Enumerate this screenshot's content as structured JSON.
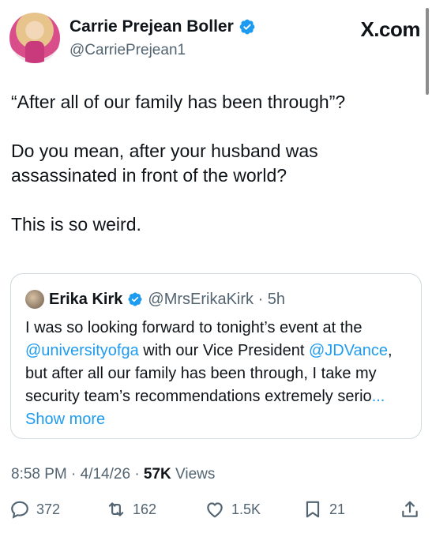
{
  "header": {
    "display_name": "Carrie Prejean Boller",
    "handle": "@CarriePrejean1",
    "site_label": "X.com"
  },
  "post": {
    "paragraphs": [
      "“After all of our family has been through”?",
      "Do you mean, after your husband was assassinated in front of the world?",
      "This is so weird."
    ]
  },
  "quoted": {
    "name": "Erika Kirk",
    "handle_time": "@MrsErikaKirk · 5h",
    "text_parts": {
      "p1": "I was so looking forward to tonight’s event at the ",
      "mention1": "@universityofga",
      "p2": " with our Vice President ",
      "mention2": "@JDVance",
      "p3": ", but after all our family has been through, I take my security team’s recommendations extremely serio",
      "show_more": "... Show more"
    }
  },
  "meta": {
    "time": "8:58 PM · 4/14/26 · ",
    "views_count": "57K",
    "views_label": " Views"
  },
  "actions": {
    "replies": "372",
    "reposts": "162",
    "likes": "1.5K",
    "bookmarks": "21"
  },
  "colors": {
    "accent": "#1d9bf0",
    "secondary_text": "#536471"
  },
  "icons": [
    "verified-badge-icon",
    "reply-icon",
    "repost-icon",
    "like-icon",
    "bookmark-icon",
    "share-icon"
  ]
}
